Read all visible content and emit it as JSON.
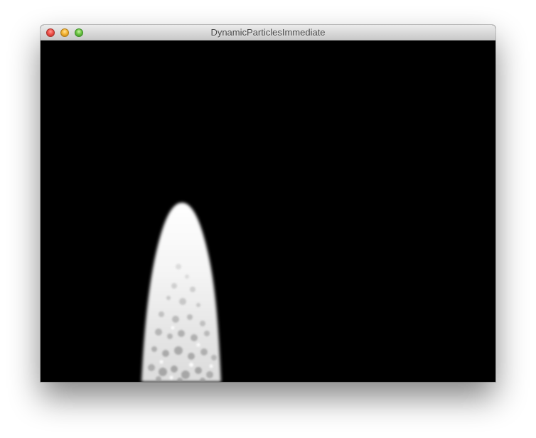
{
  "window": {
    "title": "DynamicParticlesImmediate"
  },
  "titlebar_buttons": [
    {
      "name": "close-button",
      "color": "#f0514a"
    },
    {
      "name": "minimize-button",
      "color": "#f6b532"
    },
    {
      "name": "zoom-button",
      "color": "#6dc544"
    }
  ],
  "scene": {
    "background_color": "#000000",
    "particle_color": "#ffffff"
  }
}
